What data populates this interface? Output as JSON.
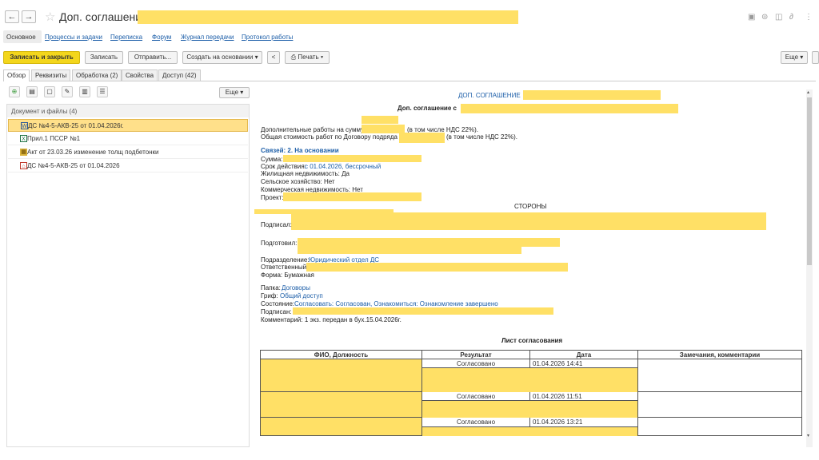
{
  "window": {
    "title": "Доп. соглашение с"
  },
  "sections": [
    "Основное",
    "Процессы и задачи",
    "Переписка",
    "Форум",
    "Журнал передачи",
    "Протокол работы"
  ],
  "toolbar": {
    "save_close": "Записать и закрыть",
    "save": "Записать",
    "send": "Отправить...",
    "create_based": "Создать на основании",
    "print": "Печать",
    "more": "Еще"
  },
  "tabs": [
    "Обзор",
    "Реквизиты",
    "Обработка (2)",
    "Свойства",
    "Доступ (42)"
  ],
  "left": {
    "more": "Еще",
    "header": "Документ и файлы (4)",
    "items": [
      {
        "label": "ДС №4-5-АКВ-25 от 01.04.2026г.",
        "icon": "word-icon"
      },
      {
        "label": "Прил.1 ПССР №1",
        "icon": "excel-icon"
      },
      {
        "label": "Акт от 23.03.26 изменение толщ подбетонки",
        "icon": "archive-icon"
      },
      {
        "label": "ДС №4-5-АКВ-25 от 01.04.2026",
        "icon": "pdf-icon"
      }
    ]
  },
  "doc": {
    "heading": "ДОП. СОГЛАШЕНИЕ",
    "subheading": "Доп. соглашение с",
    "add_work": "Дополнительные работы на сумму",
    "vat1": "(в том числе НДС 22%).",
    "total_cost": "Общая стоимость работ по Договору подряда -",
    "vat2": "(в том числе НДС 22%).",
    "links": "Связей: 2. На основании",
    "sum_label": "Сумма:",
    "validity_label": "Срок действия:",
    "validity_value": "с 01.04.2026, бессрочный",
    "housing": "Жилищная недвижимость: Да",
    "agri": "Сельское хозяйство: Нет",
    "commercial": "Коммерческая недвижимость: Нет",
    "project_label": "Проект:",
    "parties": "СТОРОНЫ",
    "signed_label": "Подписал:",
    "prepared_label": "Подготовил:",
    "dept_label": "Подразделение:",
    "dept_value": "Юридический отдел ДС",
    "resp_label": "Ответственный:",
    "form": "Форма: Бумажная",
    "folder_label": "Папка:",
    "folder_value": "Договоры",
    "grif_label": "Гриф:",
    "grif_value": "Общий доступ",
    "state_label": "Состояние:",
    "state_value": "Согласовать: Согласован, Ознакомиться: Ознакомление завершено",
    "signed2_label": "Подписан:",
    "comment": "Комментарий: 1 экз. передан в бух.15.04.2026г.",
    "sheet_title": "Лист согласования"
  },
  "approval": {
    "headers": [
      "ФИО, Должность",
      "Результат",
      "Дата",
      "Замечания, комментарии"
    ],
    "rows": [
      {
        "result": "Согласовано",
        "date": "01.04.2026 14:41"
      },
      {
        "result": "Согласовано",
        "date": "01.04.2026 11:51"
      },
      {
        "result": "Согласовано",
        "date": "01.04.2026 13:21"
      }
    ]
  }
}
